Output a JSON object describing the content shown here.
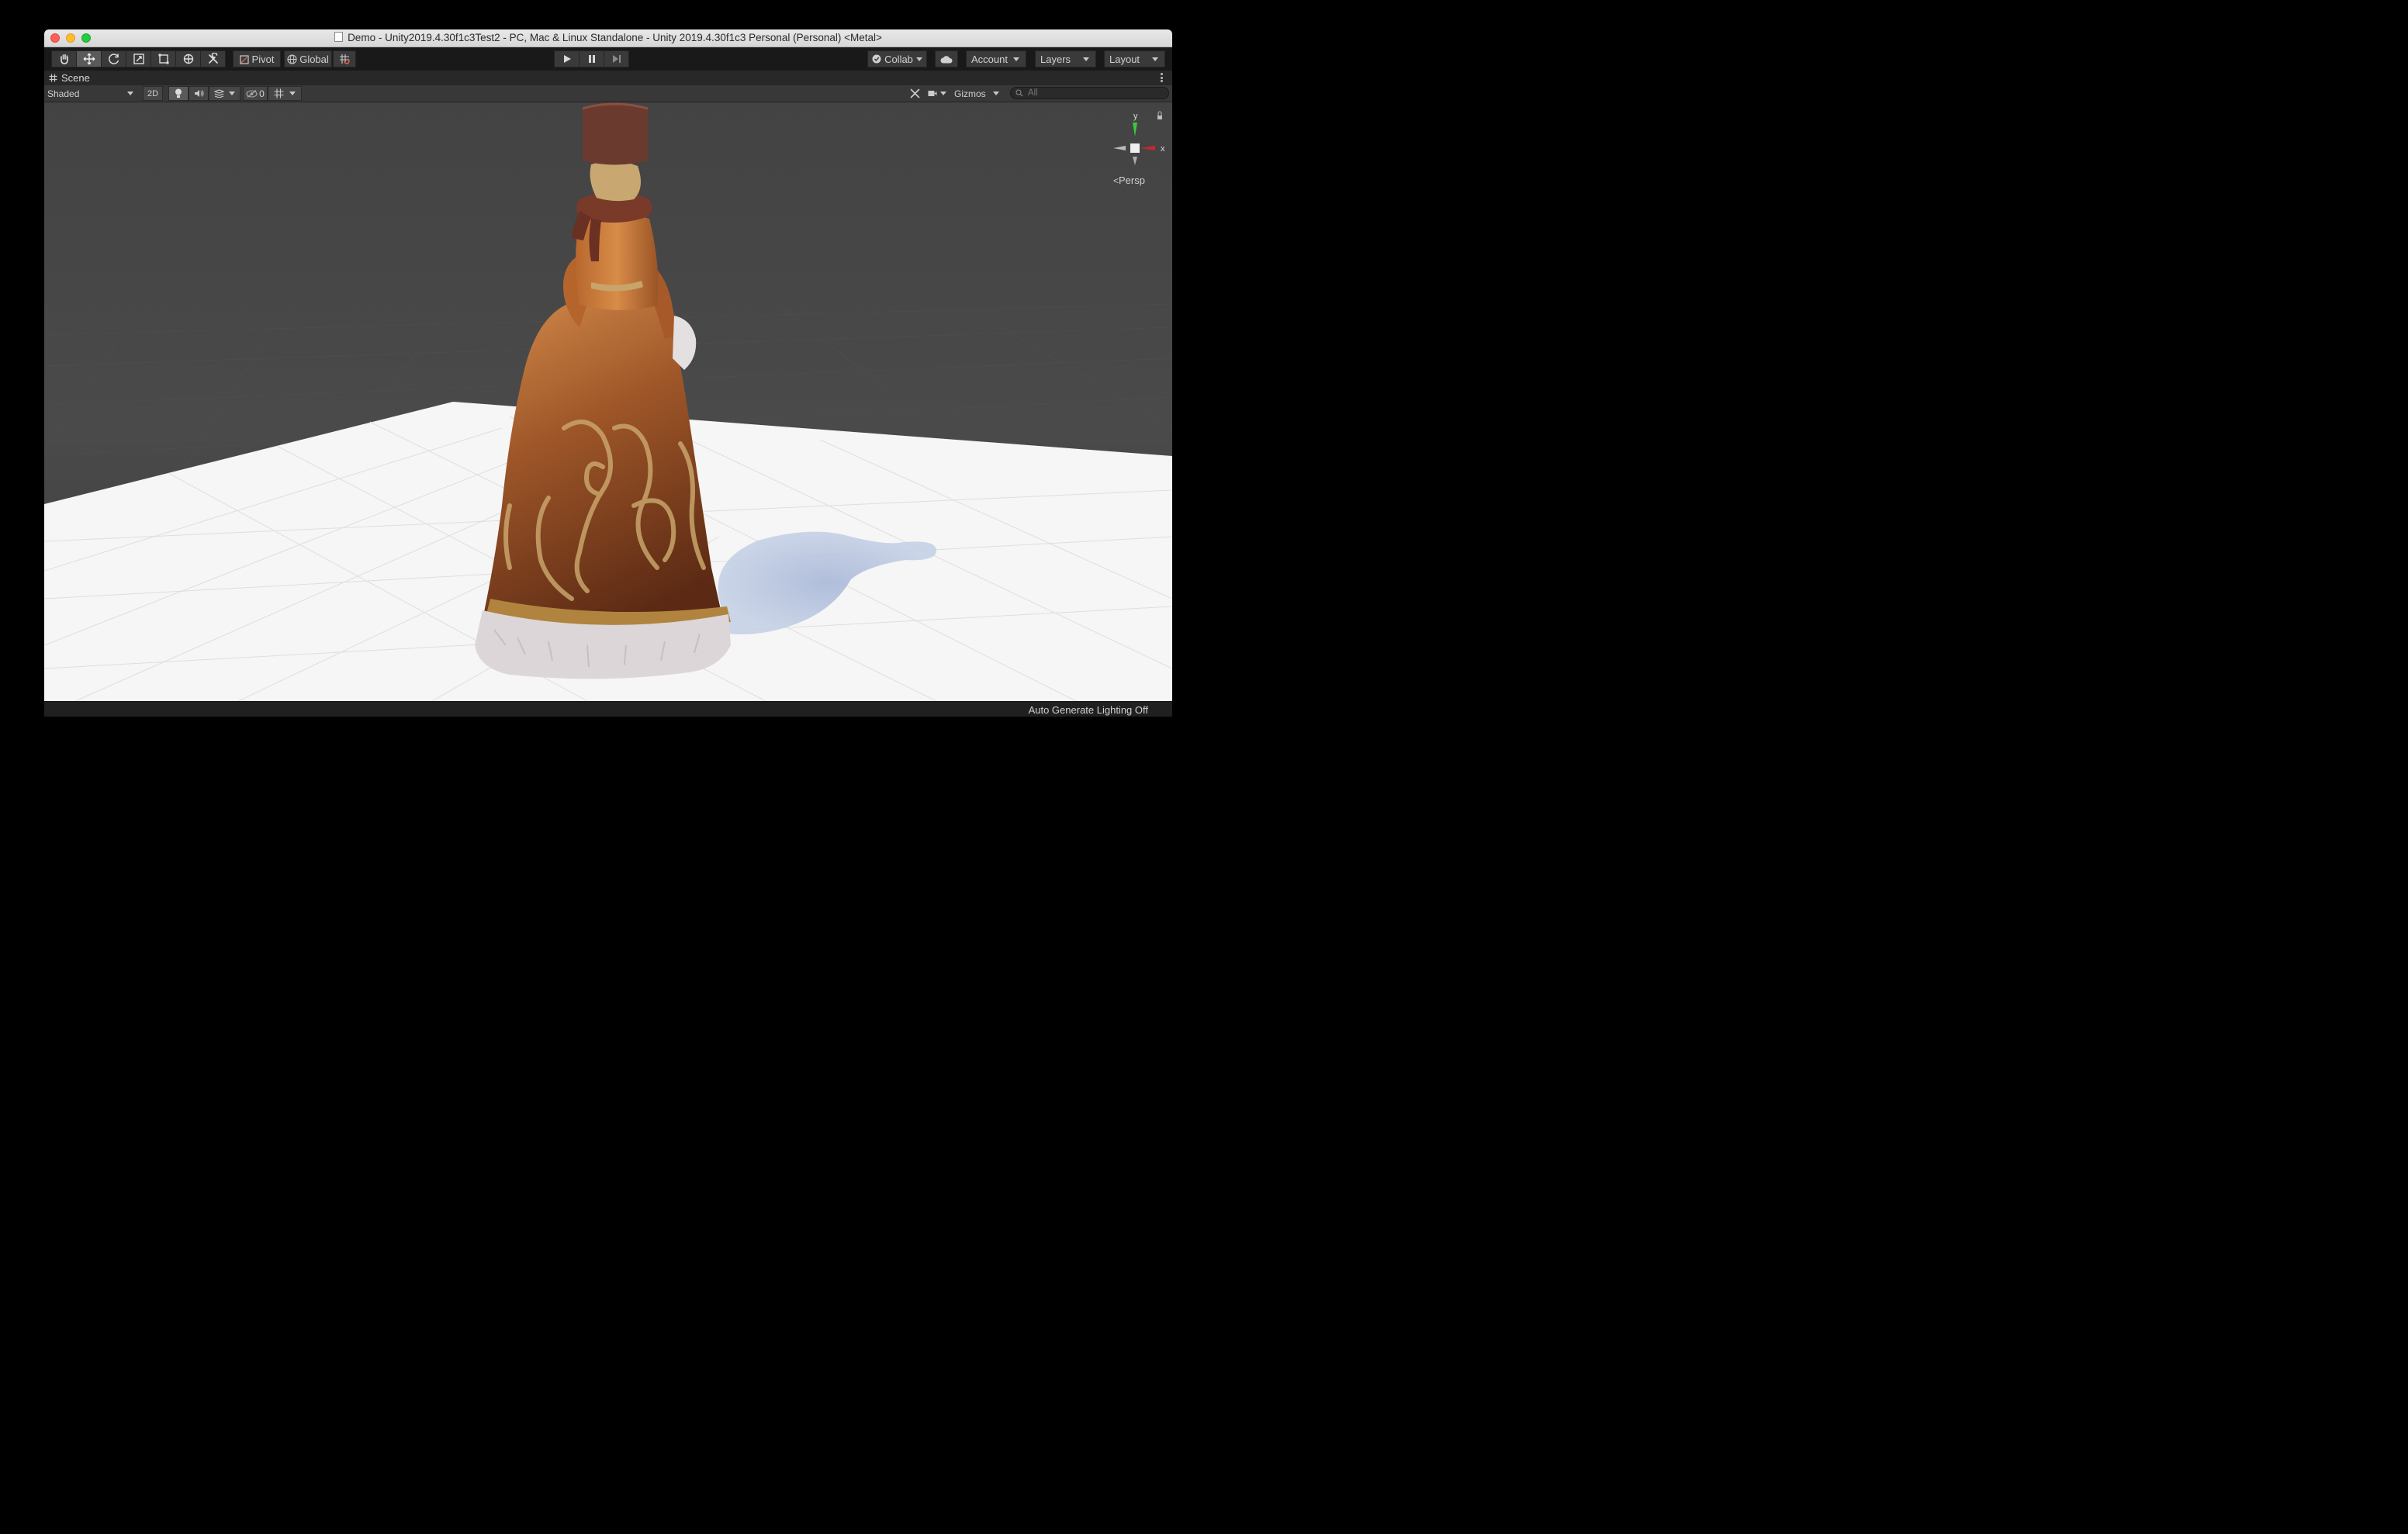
{
  "window": {
    "title": "Demo - Unity2019.4.30f1c3Test2 - PC, Mac & Linux Standalone - Unity 2019.4.30f1c3 Personal (Personal) <Metal>"
  },
  "toolbar": {
    "tools": [
      "hand-tool",
      "move-tool",
      "rotate-tool",
      "scale-tool",
      "rect-tool",
      "transform-tool",
      "custom-tool"
    ],
    "pivot_label": "Pivot",
    "global_label": "Global",
    "collab_label": "Collab",
    "account_label": "Account",
    "layers_label": "Layers",
    "layout_label": "Layout"
  },
  "scene_tab": {
    "label": "Scene"
  },
  "scene_toolbar": {
    "shading_mode": "Shaded",
    "two_d_label": "2D",
    "hidden_count": "0",
    "gizmos_label": "Gizmos",
    "search_placeholder": "All"
  },
  "gizmo": {
    "y_label": "y",
    "x_label": "x",
    "projection_label": "Persp"
  },
  "status": {
    "text": "Auto Generate Lighting Off"
  },
  "colors": {
    "dress": "#8a4a22",
    "dress_light": "#d08a4a",
    "gold_pattern": "#c9a46a",
    "fur": "#d9d4d6",
    "hat": "#6b3a2e",
    "floor": "#ffffff",
    "shadow": "#b8c4dc",
    "sky": "#454545"
  }
}
